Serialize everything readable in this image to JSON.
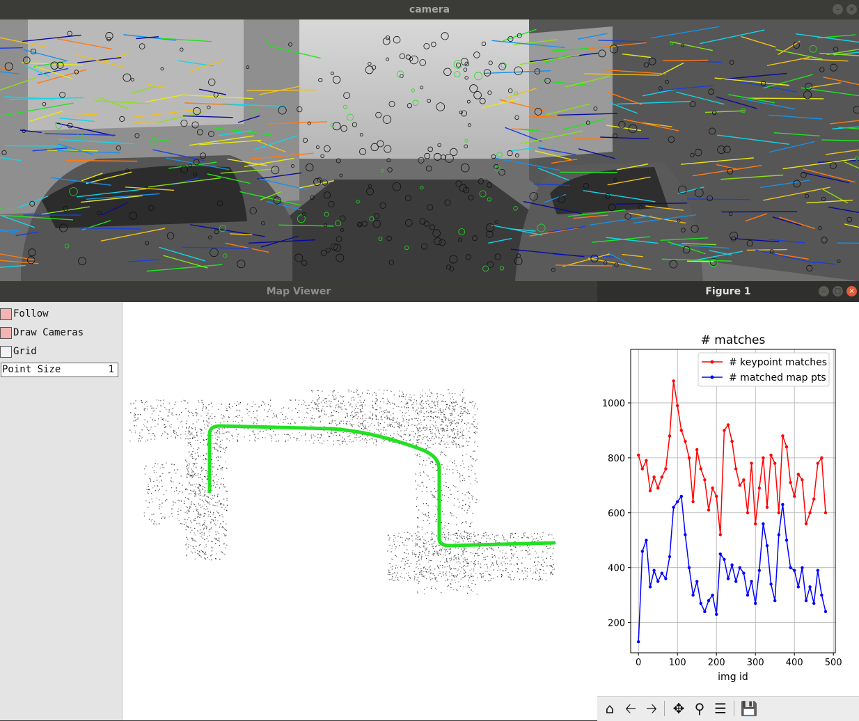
{
  "camera_window": {
    "title": "camera"
  },
  "map_window": {
    "title": "Map Viewer",
    "panel": {
      "follow_label": "Follow",
      "draw_cameras_label": "Draw Cameras",
      "grid_label": "Grid",
      "point_size_label": "Point Size",
      "point_size_value": "1"
    }
  },
  "figure_window": {
    "title": "Figure 1",
    "toolbar": [
      "home-icon",
      "back-icon",
      "forward-icon",
      "pan-icon",
      "zoom-icon",
      "configure-icon",
      "save-icon"
    ]
  },
  "colors": {
    "keypoint": "#ff0000",
    "mappts": "#0000ff",
    "trajectory": "#22e022"
  },
  "chart_data": {
    "type": "line",
    "title": "# matches",
    "xlabel": "img id",
    "ylabel": "",
    "xlim": [
      -20,
      505
    ],
    "ylim": [
      90,
      1195
    ],
    "xticks": [
      0,
      100,
      200,
      300,
      400,
      500
    ],
    "yticks": [
      200,
      400,
      600,
      800,
      1000
    ],
    "grid": true,
    "legend_position": "top-right",
    "x": [
      0,
      10,
      20,
      30,
      40,
      50,
      60,
      70,
      80,
      90,
      100,
      110,
      120,
      130,
      140,
      150,
      160,
      170,
      180,
      190,
      200,
      210,
      220,
      230,
      240,
      250,
      260,
      270,
      280,
      290,
      300,
      310,
      320,
      330,
      340,
      350,
      360,
      370,
      380,
      390,
      400,
      410,
      420,
      430,
      440,
      450,
      460,
      470,
      480
    ],
    "series": [
      {
        "name": "# keypoint matches",
        "color": "#ff0000",
        "values": [
          810,
          760,
          790,
          680,
          730,
          690,
          730,
          760,
          880,
          1080,
          990,
          900,
          860,
          800,
          640,
          830,
          760,
          720,
          610,
          690,
          660,
          520,
          900,
          920,
          860,
          760,
          700,
          720,
          600,
          780,
          560,
          690,
          800,
          620,
          810,
          780,
          600,
          880,
          840,
          710,
          660,
          740,
          720,
          560,
          600,
          650,
          780,
          800,
          600
        ]
      },
      {
        "name": "# matched map pts",
        "color": "#0000ff",
        "values": [
          130,
          460,
          500,
          330,
          390,
          350,
          380,
          360,
          440,
          620,
          640,
          660,
          520,
          400,
          300,
          350,
          270,
          240,
          280,
          300,
          230,
          450,
          430,
          360,
          410,
          350,
          400,
          380,
          300,
          350,
          270,
          390,
          560,
          480,
          340,
          280,
          520,
          630,
          500,
          400,
          390,
          330,
          400,
          280,
          330,
          270,
          390,
          300,
          240
        ]
      }
    ]
  }
}
